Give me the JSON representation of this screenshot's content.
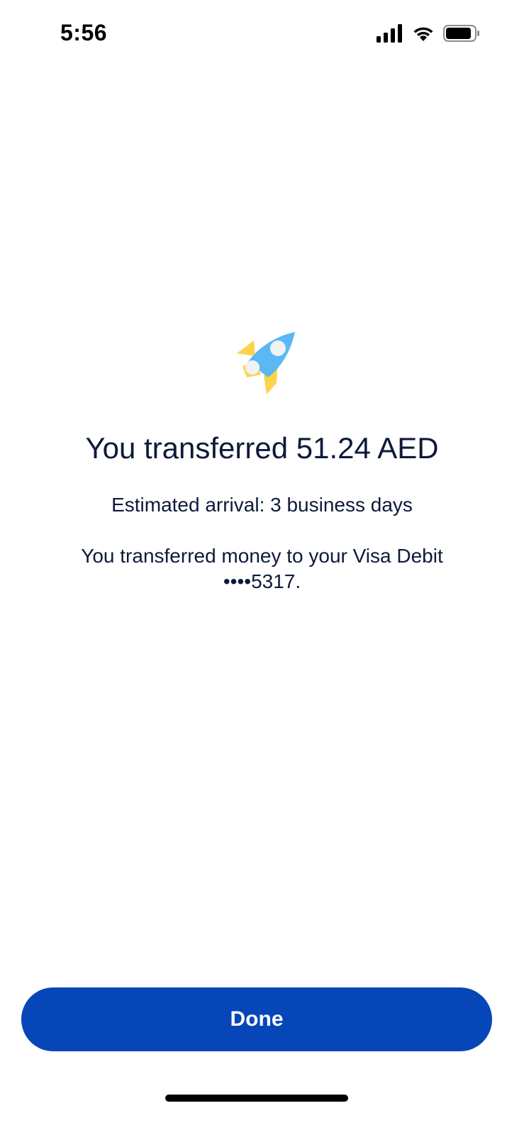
{
  "status_bar": {
    "time": "5:56",
    "icons": [
      "signal-icon",
      "wifi-icon",
      "battery-icon"
    ]
  },
  "confirmation": {
    "icon": "rocket-icon",
    "title": "You transferred 51.24 AED",
    "arrival": "Estimated arrival: 3 business days",
    "description": "You transferred money to your Visa Debit ••••5317."
  },
  "actions": {
    "done_label": "Done"
  },
  "colors": {
    "accent": "#0646b8",
    "text": "#0d1a3a",
    "rocket_body": "#5ab8f5",
    "rocket_fins": "#ffd24d"
  }
}
